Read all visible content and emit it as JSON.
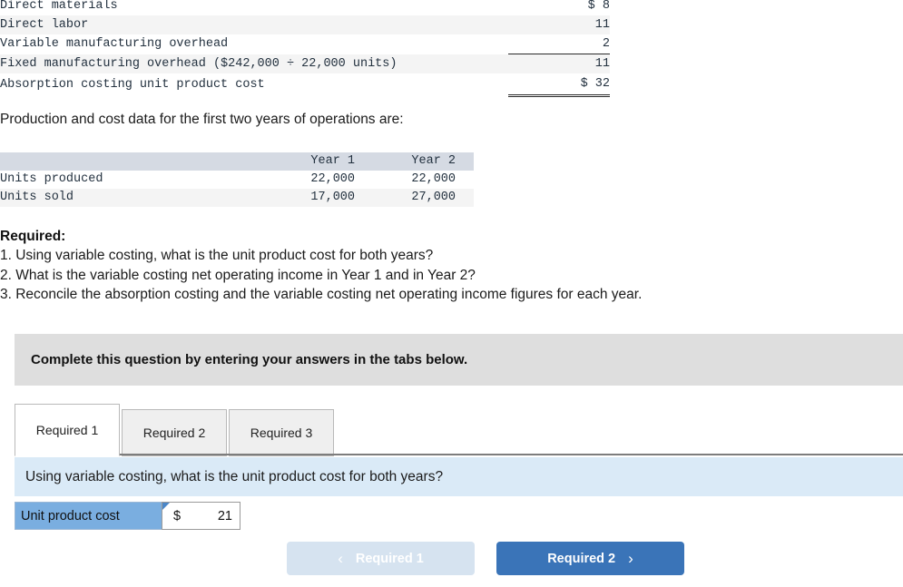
{
  "cost_table": {
    "rows": [
      {
        "label": "Direct materials",
        "value": "8",
        "currency": "$"
      },
      {
        "label": "Direct labor",
        "value": "11",
        "currency": ""
      },
      {
        "label": "Variable manufacturing overhead",
        "value": "2",
        "currency": ""
      },
      {
        "label": "Fixed manufacturing overhead ($242,000 ÷ 22,000 units)",
        "value": "11",
        "currency": ""
      }
    ],
    "total": {
      "label": "Absorption costing unit product cost",
      "currency": "$",
      "value": "32"
    }
  },
  "production_intro": "Production and cost data for the first two years of operations are:",
  "production_table": {
    "headers": [
      "",
      "Year 1",
      "Year 2"
    ],
    "rows": [
      {
        "label": "Units produced",
        "year1": "22,000",
        "year2": "22,000"
      },
      {
        "label": "Units sold",
        "year1": "17,000",
        "year2": "27,000"
      }
    ]
  },
  "required": {
    "title": "Required:",
    "items": [
      "1. Using variable costing, what is the unit product cost for both years?",
      "2. What is the variable costing net operating income in Year 1 and in Year 2?",
      "3. Reconcile the absorption costing and the variable costing net operating income figures for each year."
    ]
  },
  "instruction_banner": "Complete this question by entering your answers in the tabs below.",
  "tabs": [
    {
      "label": "Required 1",
      "active": true
    },
    {
      "label": "Required 2",
      "active": false
    },
    {
      "label": "Required 3",
      "active": false
    }
  ],
  "question_bar": "Using variable costing, what is the unit product cost for both years?",
  "answer_row": {
    "label": "Unit product cost",
    "currency": "$",
    "value": "21"
  },
  "nav": {
    "prev_label": "Required 1",
    "prev_chevron": "‹",
    "next_label": "Required 2",
    "next_chevron": "›"
  },
  "colors": {
    "accent_blue": "#3a74b8",
    "question_bar": "#daeaf7",
    "banner_gray": "#dedede",
    "answer_label_blue": "#7aaee0",
    "table_header": "#d5dae3"
  }
}
